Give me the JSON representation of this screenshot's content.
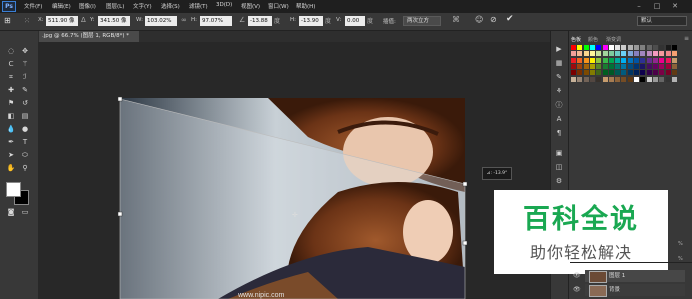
{
  "menu": {
    "items": [
      "文件(F)",
      "编辑(E)",
      "图像(I)",
      "图层(L)",
      "文字(Y)",
      "选择(S)",
      "滤镜(T)",
      "3D(D)",
      "视图(V)",
      "窗口(W)",
      "帮助(H)"
    ]
  },
  "app": {
    "logo": "Ps"
  },
  "options": {
    "x_label": "X:",
    "x_value": "511.90 像",
    "y_label": "Y:",
    "y_value": "341.50 像",
    "w_label": "W:",
    "w_value": "103.02%",
    "h_label": "H:",
    "h_value": "97.07%",
    "angle_value": "-13.88",
    "skew_h_label": "H:",
    "skew_h_value": "-13.90",
    "skew_v_label": "V:",
    "skew_v_value": "0.00",
    "interp_label": "插值:",
    "interp_value": "两次立方",
    "workspace_value": "默认"
  },
  "document": {
    "tab_label": ".jpg @ 66.7% (图层 1, RGB/8*) *"
  },
  "tooltip": {
    "text": "⊿: -13.9°"
  },
  "panel": {
    "tabs": [
      "色板",
      "颜色",
      "渐变调"
    ],
    "colors": {
      "row1": [
        "#ff0000",
        "#ffff00",
        "#00ff00",
        "#00ffff",
        "#0000ff",
        "#ff00ff",
        "#ffffff",
        "#e6e6e6",
        "#cccccc",
        "#b3b3b3",
        "#999999",
        "#808080",
        "#666666",
        "#4d4d4d",
        "#333333",
        "#1a1a1a",
        "#000000"
      ],
      "row2": [
        "#f2a09a",
        "#f6b993",
        "#fbd78e",
        "#fff79a",
        "#c8e29b",
        "#a2d49c",
        "#7ccb9c",
        "#6ccbc4",
        "#6bcff6",
        "#7ea6d8",
        "#8781bd",
        "#a186be",
        "#bd8cbf",
        "#f49ac1",
        "#f5989d",
        "#f0888a",
        "#f7a072"
      ],
      "row3": [
        "#ed1c24",
        "#f26522",
        "#f7941d",
        "#fff200",
        "#8dc63f",
        "#39b54a",
        "#00a651",
        "#00a99d",
        "#00aeef",
        "#0072bc",
        "#0054a6",
        "#2e3192",
        "#662d91",
        "#92278f",
        "#ec008c",
        "#ed145b",
        "#c69c6d"
      ],
      "row4": [
        "#9e0b0f",
        "#a0410d",
        "#a36209",
        "#aba000",
        "#598527",
        "#197b30",
        "#007236",
        "#00746b",
        "#0076a3",
        "#004b80",
        "#003471",
        "#1b1464",
        "#440e62",
        "#630460",
        "#9e005d",
        "#9e0039",
        "#8c6239"
      ],
      "row5": [
        "#790000",
        "#7b2e00",
        "#7d4900",
        "#827b00",
        "#406618",
        "#005e20",
        "#005826",
        "#005952",
        "#005b7f",
        "#003663",
        "#002157",
        "#0d004c",
        "#32004b",
        "#4b0049",
        "#7b0046",
        "#7a0026",
        "#603913"
      ],
      "row6": [
        "#c7b299",
        "#998675",
        "#736357",
        "#534741",
        "#37302a",
        "#c69c6d",
        "#a67c52",
        "#8c6239",
        "#754c24",
        "#603913",
        "#ffffff",
        "#000000",
        "#cccccc",
        "#999999",
        "#666666",
        "#333333",
        "#b3b3b3"
      ]
    }
  },
  "layers": {
    "layer1": "图层 1",
    "background": "背景"
  },
  "watermark": {
    "title": "百科全说",
    "subtitle": "助你轻松解决",
    "title_color": "#1aa852"
  },
  "image_text": {
    "url_caption": "www.nipic.com"
  }
}
